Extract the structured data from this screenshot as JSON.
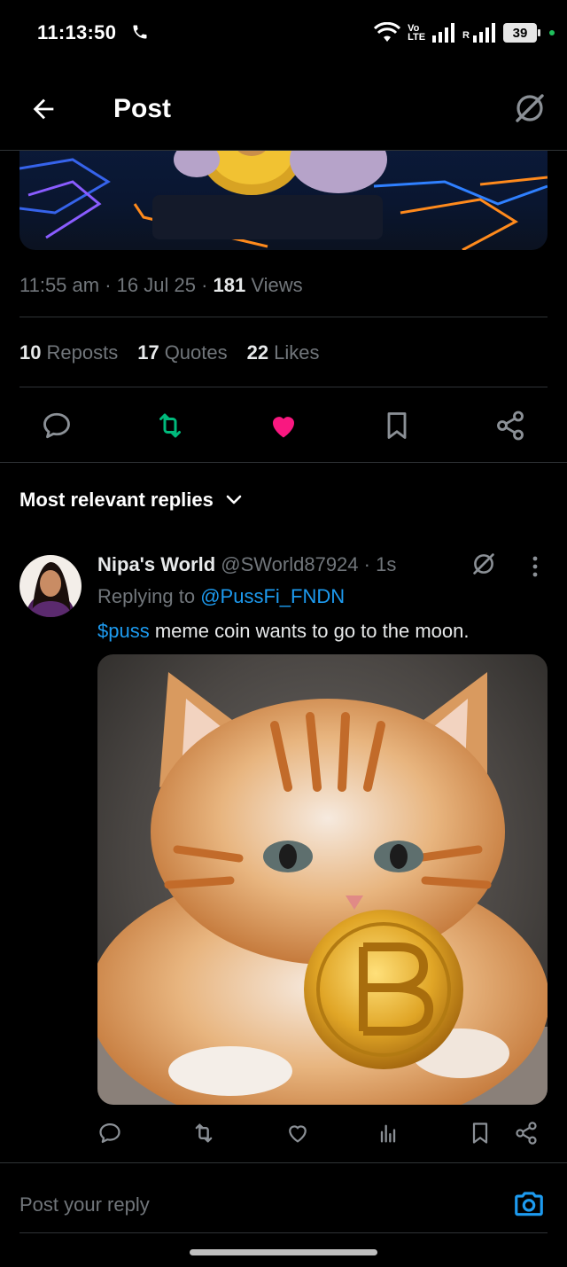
{
  "status_bar": {
    "time": "11:13:50",
    "volte_top": "Vo",
    "volte_bottom": "LTE",
    "roaming": "R",
    "battery": "39"
  },
  "header": {
    "title": "Post"
  },
  "post": {
    "time": "11:55 am",
    "date": "16 Jul 25",
    "views_count": "181",
    "views_label": "Views",
    "reposts_count": "10",
    "reposts_label": "Reposts",
    "quotes_count": "17",
    "quotes_label": "Quotes",
    "likes_count": "22",
    "likes_label": "Likes",
    "liked": true
  },
  "replies": {
    "sort_label": "Most relevant replies",
    "items": [
      {
        "name": "Nipa's World",
        "handle": "@SWorld87924",
        "age": "1s",
        "replying_prefix": "Replying to",
        "replying_to": "@PussFi_FNDN",
        "cashtag": "$puss",
        "text": "meme coin wants to go to the moon."
      }
    ]
  },
  "composer": {
    "placeholder": "Post your reply"
  },
  "colors": {
    "accent": "#1d9bf0",
    "like": "#f91880",
    "repost": "#00ba7c",
    "muted": "#71767b"
  },
  "icons": [
    "phone-icon",
    "wifi-icon",
    "signal-icon",
    "back-arrow-icon",
    "grok-icon",
    "reply-icon",
    "repost-icon",
    "heart-icon",
    "bookmark-icon",
    "share-icon",
    "chevron-down-icon",
    "more-icon",
    "analytics-icon",
    "camera-icon"
  ]
}
